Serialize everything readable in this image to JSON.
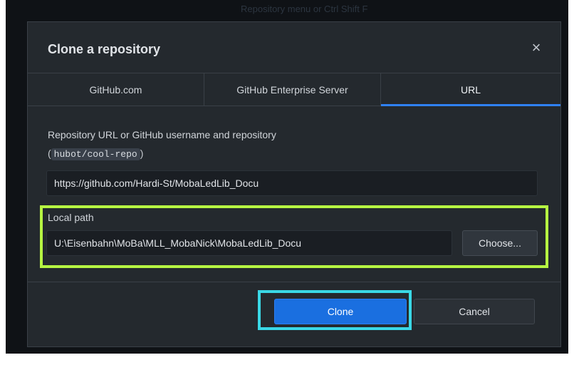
{
  "backdrop": {
    "hint": "Repository menu or  Ctrl  Shift  F"
  },
  "dialog": {
    "title": "Clone a repository",
    "close_icon": "×"
  },
  "tabs": [
    {
      "label": "GitHub.com",
      "active": false
    },
    {
      "label": "GitHub Enterprise Server",
      "active": false
    },
    {
      "label": "URL",
      "active": true
    }
  ],
  "url_field": {
    "label": "Repository URL or GitHub username and repository",
    "hint_open": "(",
    "hint_code": "hubot/cool-repo",
    "hint_close": ")",
    "value": "https://github.com/Hardi-St/MobaLedLib_Docu"
  },
  "local_path": {
    "label": "Local path",
    "value": "U:\\Eisenbahn\\MoBa\\MLL_MobaNick\\MobaLedLib_Docu",
    "choose_label": "Choose..."
  },
  "footer": {
    "clone_label": "Clone",
    "cancel_label": "Cancel"
  },
  "colors": {
    "dialog_bg": "#24292e",
    "accent": "#2f81f7",
    "clone_button": "#1a6fe0",
    "highlight_green": "#b6f542",
    "highlight_cyan": "#3ad8e6"
  }
}
